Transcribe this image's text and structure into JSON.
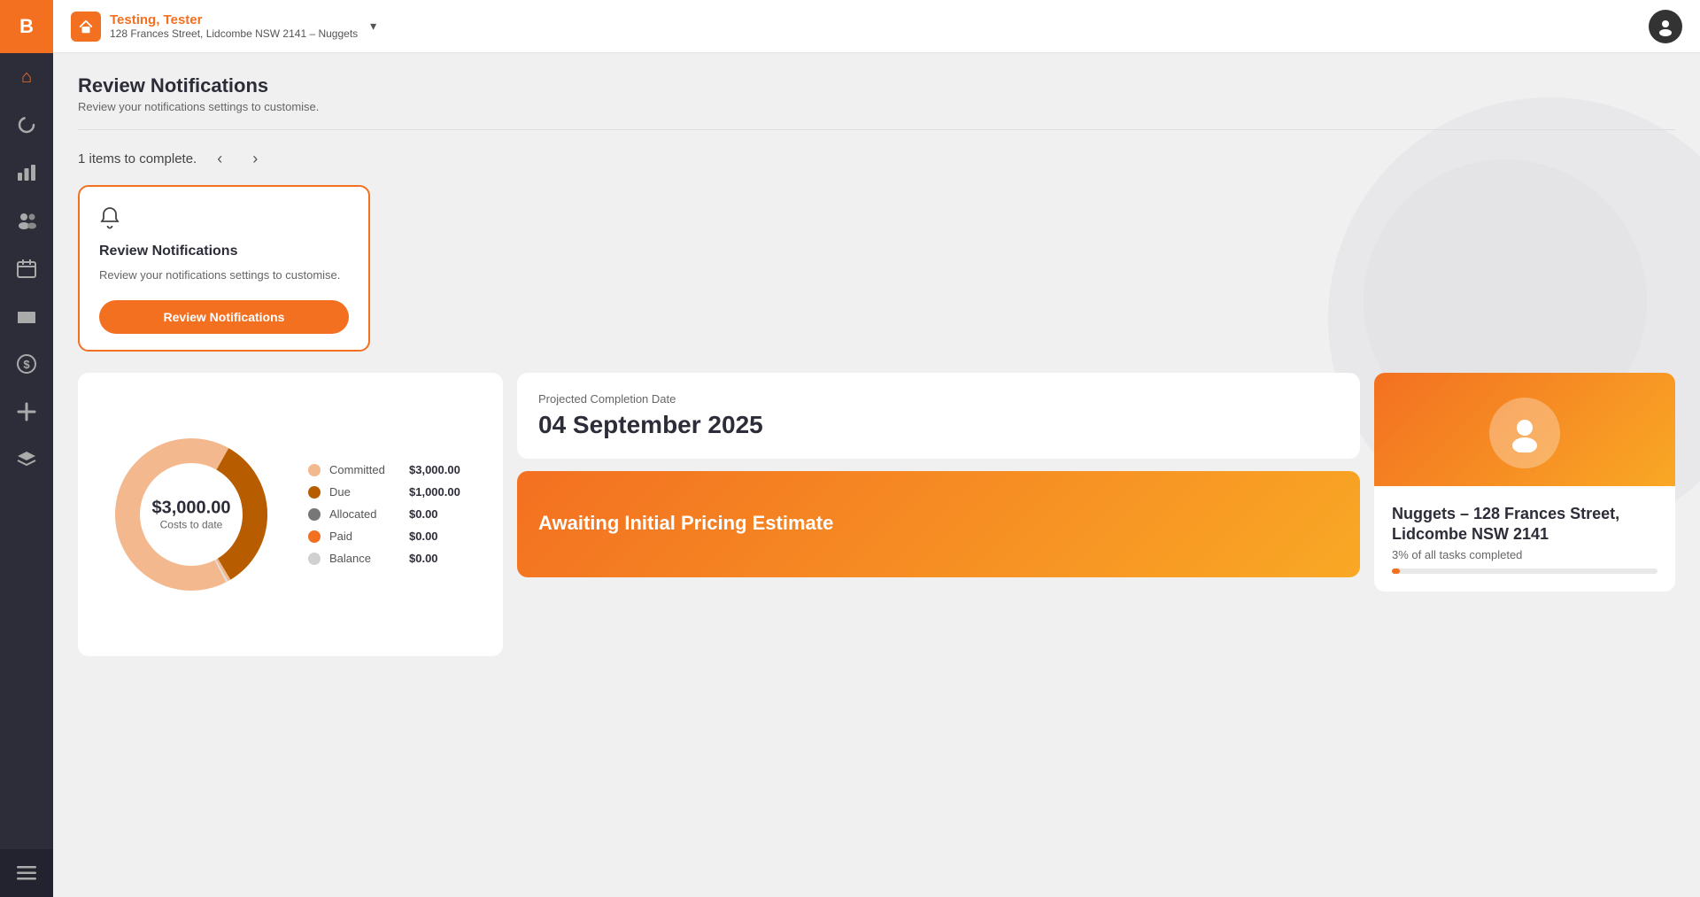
{
  "brand": {
    "logo": "B",
    "accent_color": "#f37021"
  },
  "sidebar": {
    "items": [
      {
        "name": "home-icon",
        "icon": "⌂",
        "active": true
      },
      {
        "name": "loading-icon",
        "icon": "◔",
        "active": false
      },
      {
        "name": "chart-icon",
        "icon": "▦",
        "active": false
      },
      {
        "name": "people-icon",
        "icon": "👥",
        "active": false
      },
      {
        "name": "calendar-icon",
        "icon": "📅",
        "active": false
      },
      {
        "name": "folder-icon",
        "icon": "📁",
        "active": false
      },
      {
        "name": "dollar-icon",
        "icon": "💲",
        "active": false
      },
      {
        "name": "tools-icon",
        "icon": "🔧",
        "active": false
      },
      {
        "name": "layers-icon",
        "icon": "◧",
        "active": false
      }
    ],
    "bottom_icon": "☰"
  },
  "topbar": {
    "user_name": "Testing, Tester",
    "property_address": "128 Frances Street, Lidcombe NSW 2141 – Nuggets"
  },
  "page": {
    "title": "Review Notifications",
    "subtitle": "Review your notifications settings to customise."
  },
  "items_row": {
    "count_text": "1 items to complete."
  },
  "task_card": {
    "icon": "🔔",
    "title": "Review Notifications",
    "description": "Review your notifications settings to customise.",
    "button_label": "Review Notifications"
  },
  "costs": {
    "center_amount": "$3,000.00",
    "center_label": "Costs to date",
    "legend": [
      {
        "name": "Committed",
        "value": "$3,000.00",
        "color": "#f4b88e"
      },
      {
        "name": "Due",
        "value": "$1,000.00",
        "color": "#b85c00"
      },
      {
        "name": "Allocated",
        "value": "$0.00",
        "color": "#777"
      },
      {
        "name": "Paid",
        "value": "$0.00",
        "color": "#f37021"
      },
      {
        "name": "Balance",
        "value": "$0.00",
        "color": "#d0d0d0"
      }
    ]
  },
  "projection": {
    "label": "Projected Completion Date",
    "date": "04 September 2025"
  },
  "awaiting": {
    "text": "Awaiting Initial Pricing Estimate"
  },
  "property": {
    "title": "Nuggets – 128 Frances Street, Lidcombe NSW 2141",
    "progress_label": "3% of all tasks completed",
    "progress_pct": 3
  }
}
